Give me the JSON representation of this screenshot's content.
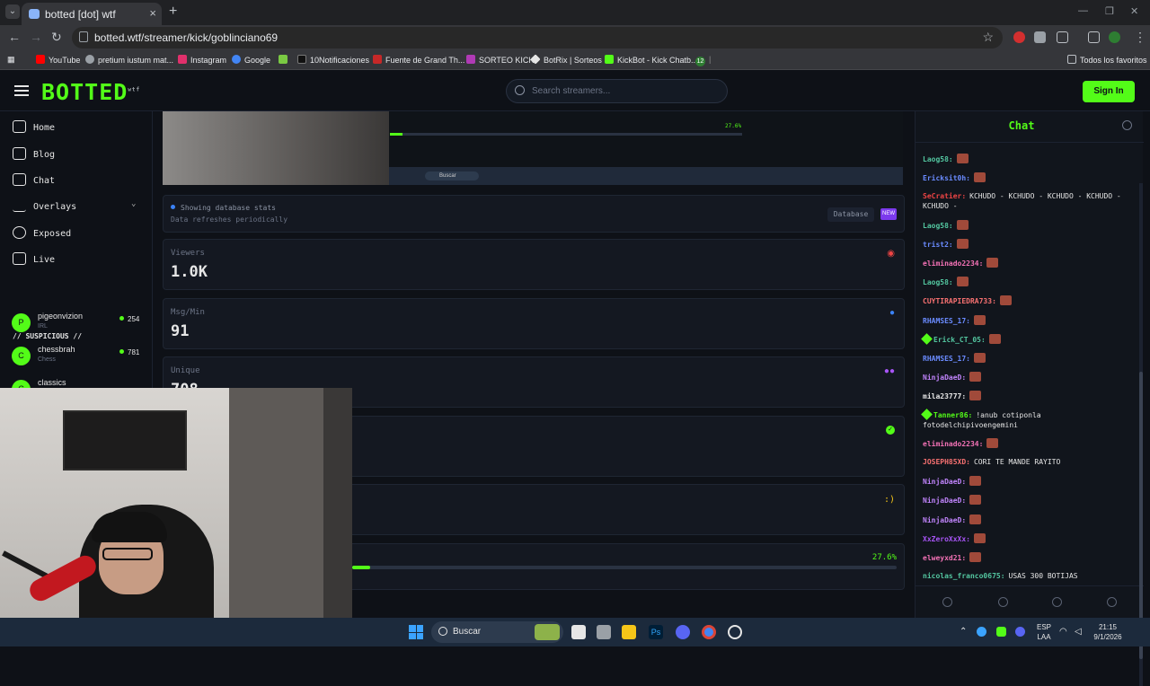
{
  "browser": {
    "tab_title": "botted [dot] wtf",
    "new_tab": "+",
    "url": "botted.wtf/streamer/kick/goblinciano69",
    "bookmarks": [
      {
        "label": "YouTube",
        "color": "#ff0000"
      },
      {
        "label": "pretium iustum mat...",
        "color": "#9aa0a6"
      },
      {
        "label": "Instagram",
        "color": "#e1306c"
      },
      {
        "label": "Google",
        "color": "#4285f4"
      },
      {
        "label": "",
        "color": "#7ac943"
      },
      {
        "label": "10Notificaciones",
        "color": "#111111"
      },
      {
        "label": "Fuente de Grand Th...",
        "color": "#c62828"
      },
      {
        "label": "SORTEO KICK",
        "color": "#b03ab5"
      },
      {
        "label": "BotRix | Sorteos",
        "color": "#e6e6e6"
      },
      {
        "label": "KickBot - Kick Chatb...",
        "color": "#53fc18"
      },
      {
        "label": "12",
        "color": "#2e7d32"
      }
    ],
    "all_bookmarks": "Todos los favoritos"
  },
  "app": {
    "logo": "BOTTED",
    "logo_sup": "wtf",
    "search_placeholder": "Search streamers...",
    "signin": "Sign In"
  },
  "sidebar": {
    "items": [
      {
        "label": "Home"
      },
      {
        "label": "Blog"
      },
      {
        "label": "Chat"
      },
      {
        "label": "Overlays"
      },
      {
        "label": "Exposed"
      },
      {
        "label": "Live"
      }
    ],
    "suspicious_header": "// SUSPICIOUS //",
    "channels": [
      {
        "initial": "P",
        "name": "pigeonvizion",
        "category": "IRL",
        "viewers": "254"
      },
      {
        "initial": "C",
        "name": "chessbrah",
        "category": "Chess",
        "viewers": "781"
      },
      {
        "initial": "C",
        "name": "classics",
        "category": "",
        "viewers": ""
      }
    ]
  },
  "preview": {
    "progress_label": "27.6%",
    "taskbar_search": "Buscar"
  },
  "stats": {
    "info_line1": "Showing database stats",
    "info_line2": "Data refreshes periodically",
    "database_label": "Database",
    "new_badge": "NEW",
    "viewers_label": "Viewers",
    "viewers_value": "1.0K",
    "msgmin_label": "Msg/Min",
    "msgmin_value": "91",
    "unique_label": "Unique",
    "unique_value": "708",
    "smiley": ":)",
    "progress_label": "27.6%",
    "progress_fraction": 0.276,
    "colors": {
      "accent": "#53fc18",
      "eye": "#ef4444",
      "chat": "#3b82f6",
      "users": "#a855f7"
    }
  },
  "chat": {
    "title": "Chat",
    "messages": [
      {
        "user": "Laog58:",
        "color": "#53c6a0",
        "text": "",
        "emote": true
      },
      {
        "user": "Ericksit0h:",
        "color": "#6a8bff",
        "text": "",
        "emote": true
      },
      {
        "user": "SeCratier:",
        "color": "#ef4444",
        "text": "KCHUDO - KCHUDO - KCHUDO - KCHUDO - KCHUDO -",
        "emote": false
      },
      {
        "user": "Laog58:",
        "color": "#53c6a0",
        "text": "",
        "emote": true
      },
      {
        "user": "trist2:",
        "color": "#6a8bff",
        "text": "",
        "emote": true
      },
      {
        "user": "eliminado2234:",
        "color": "#f472b6",
        "text": "",
        "emote": true
      },
      {
        "user": "Laog58:",
        "color": "#53c6a0",
        "text": "",
        "emote": true
      },
      {
        "user": "CUYTIRAPIEDRA733:",
        "color": "#f87171",
        "text": "",
        "emote": true
      },
      {
        "user": "RHAMSES_17:",
        "color": "#6a8bff",
        "text": "",
        "emote": true
      },
      {
        "user": "Erick_CT_05:",
        "color": "#53c6a0",
        "text": "",
        "emote": true,
        "badge": true
      },
      {
        "user": "RHAMSES_17:",
        "color": "#6a8bff",
        "text": "",
        "emote": true
      },
      {
        "user": "NinjaDaeD:",
        "color": "#c084fc",
        "text": "",
        "emote": true
      },
      {
        "user": "mila23777:",
        "color": "#e6e6e6",
        "text": "",
        "emote": true
      },
      {
        "user": "Tanner86:",
        "color": "#53fc18",
        "text": "!anub cotiponla fotodelchipivoengemini",
        "emote": false,
        "badge": true
      },
      {
        "user": "eliminado2234:",
        "color": "#f472b6",
        "text": "",
        "emote": true
      },
      {
        "user": "JOSEPH85XD:",
        "color": "#f87171",
        "text": "CORI TE MANDE RAYITO",
        "emote": false
      },
      {
        "user": "NinjaDaeD:",
        "color": "#c084fc",
        "text": "",
        "emote": true
      },
      {
        "user": "NinjaDaeD:",
        "color": "#c084fc",
        "text": "",
        "emote": true
      },
      {
        "user": "NinjaDaeD:",
        "color": "#c084fc",
        "text": "",
        "emote": true
      },
      {
        "user": "XxZeroXxXx:",
        "color": "#a855f7",
        "text": "",
        "emote": true
      },
      {
        "user": "elweyxd21:",
        "color": "#f472b6",
        "text": "",
        "emote": true
      },
      {
        "user": "nicolas_franco0675:",
        "color": "#53c6a0",
        "text": "USAS 300 BOTIJAS",
        "emote": false
      },
      {
        "user": "nicolas_franco0675:",
        "color": "#53c6a0",
        "text": "USAS 300 BOTIJAS",
        "emote": false
      }
    ]
  },
  "taskbar": {
    "search": "Buscar",
    "lang_line1": "ESP",
    "lang_line2": "LAA",
    "time": "21:15",
    "date": "9/1/2026"
  }
}
